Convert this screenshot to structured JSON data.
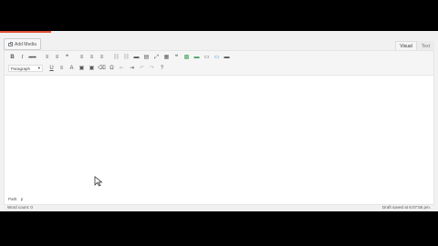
{
  "colors": {
    "accent": "#e0533a",
    "background": "#f1f1f1"
  },
  "add_media": {
    "label": "Add Media",
    "icon": "media-icon"
  },
  "tabs": [
    {
      "label": "Visual",
      "active": true
    },
    {
      "label": "Text",
      "active": false
    }
  ],
  "toolbar": {
    "row1": [
      {
        "glyph": "B",
        "icon": "bold-icon"
      },
      {
        "glyph": "I",
        "icon": "italic-icon"
      },
      {
        "glyph": "ABC",
        "icon": "strikethrough-icon"
      },
      {
        "glyph": "≡",
        "icon": "bulleted-list-icon"
      },
      {
        "glyph": "≡",
        "icon": "numbered-list-icon"
      },
      {
        "glyph": "❝",
        "icon": "blockquote-icon"
      },
      {
        "glyph": "≡",
        "icon": "align-left-icon"
      },
      {
        "glyph": "≡",
        "icon": "align-center-icon"
      },
      {
        "glyph": "≡",
        "icon": "align-right-icon"
      },
      {
        "glyph": "⛓",
        "icon": "insert-link-icon"
      },
      {
        "glyph": "⛓",
        "icon": "remove-link-icon"
      },
      {
        "glyph": "▬",
        "icon": "read-more-icon"
      },
      {
        "glyph": "▤",
        "icon": "toolbar-toggle-icon"
      },
      {
        "glyph": "⤢",
        "icon": "fullscreen-icon"
      },
      {
        "glyph": "▦",
        "icon": "table-icon"
      },
      {
        "glyph": "❝",
        "icon": "quote-icon"
      },
      {
        "glyph": "▩",
        "icon": "gallery-icon"
      },
      {
        "glyph": "▬",
        "icon": "horizontal-rule-icon"
      },
      {
        "glyph": "▭",
        "icon": "layout-icon"
      },
      {
        "glyph": "▭",
        "icon": "box-icon"
      },
      {
        "glyph": "▬",
        "icon": "divider-icon"
      }
    ],
    "format_select": {
      "value": "Paragraph"
    },
    "row2": [
      {
        "glyph": "U",
        "icon": "underline-icon"
      },
      {
        "glyph": "≡",
        "icon": "justify-icon"
      },
      {
        "glyph": "A",
        "icon": "text-color-icon"
      },
      {
        "glyph": "▣",
        "icon": "paste-as-text-icon"
      },
      {
        "glyph": "▣",
        "icon": "paste-from-word-icon"
      },
      {
        "glyph": "⌫",
        "icon": "clear-formatting-icon"
      },
      {
        "glyph": "Ω",
        "icon": "special-character-icon"
      },
      {
        "glyph": "⇤",
        "icon": "outdent-icon"
      },
      {
        "glyph": "⇥",
        "icon": "indent-icon"
      },
      {
        "glyph": "↶",
        "icon": "undo-icon"
      },
      {
        "glyph": "↷",
        "icon": "redo-icon"
      },
      {
        "glyph": "?",
        "icon": "help-icon"
      }
    ]
  },
  "statusbar": {
    "path_label": "Path:",
    "path_value": "p"
  },
  "footer": {
    "word_count": "Word count: 0",
    "draft_saved": "Draft saved at 6:07:55 pm."
  }
}
